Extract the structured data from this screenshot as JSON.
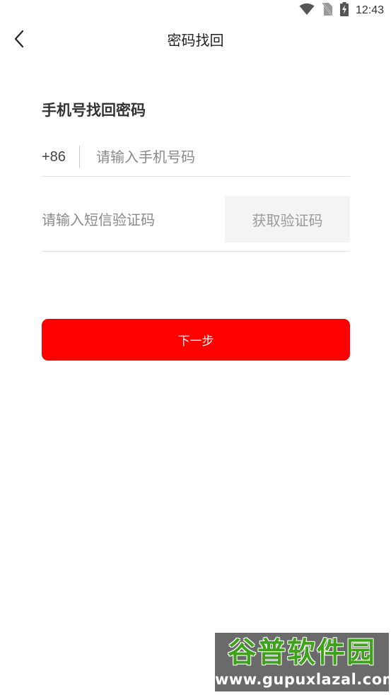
{
  "status_bar": {
    "time": "12:43",
    "icons": [
      "wifi-icon",
      "no-sim-icon",
      "battery-charging-icon"
    ]
  },
  "nav": {
    "back_icon": "chevron-left-icon",
    "title": "密码找回"
  },
  "form": {
    "heading": "手机号找回密码",
    "country_code": "+86",
    "phone_placeholder": "请输入手机号码",
    "code_placeholder": "请输入短信验证码",
    "get_code_label": "获取验证码"
  },
  "next_button": {
    "label": "下一步",
    "color": "#fe0000"
  },
  "watermark": {
    "logo_text": "谷普软件园",
    "url": "www.gupuxlazal.com"
  }
}
